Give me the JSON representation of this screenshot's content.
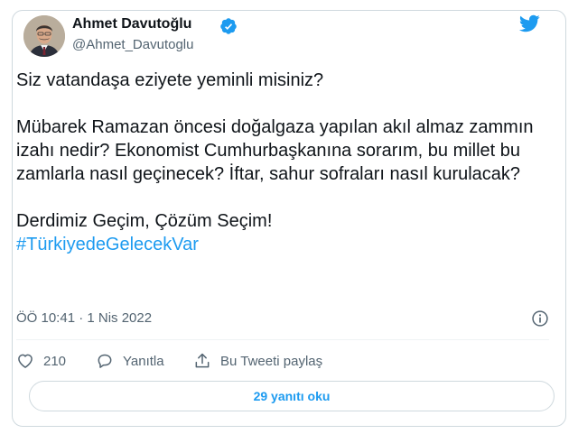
{
  "author": {
    "name": "Ahmet Davutoğlu",
    "handle": "@Ahmet_Davutoglu",
    "verified": true
  },
  "tweet": {
    "paragraphs": [
      "Siz vatandaşa eziyete yeminli misiniz?",
      "Mübarek Ramazan öncesi doğalgaza yapılan akıl almaz zammın izahı nedir? Ekonomist Cumhurbaşkanına sorarım, bu millet bu zamlarla nasıl geçinecek? İftar, sahur sofraları nasıl kurulacak?",
      "Derdimiz Geçim, Çözüm Seçim!"
    ],
    "hashtag": "#TürkiyedeGelecekVar",
    "timestamp": "ÖÖ 10:41 · 1 Nis 2022"
  },
  "actions": {
    "like_count": "210",
    "reply_label": "Yanıtla",
    "share_label": "Bu Tweeti paylaş"
  },
  "replies_button_label": "29 yanıtı oku",
  "colors": {
    "accent": "#1d9bf0",
    "text": "#0f1419",
    "secondary": "#536471",
    "border": "#cfd9de"
  },
  "icons": [
    "verified-badge-icon",
    "twitter-bird-icon",
    "info-icon",
    "heart-icon",
    "reply-icon",
    "share-icon"
  ]
}
